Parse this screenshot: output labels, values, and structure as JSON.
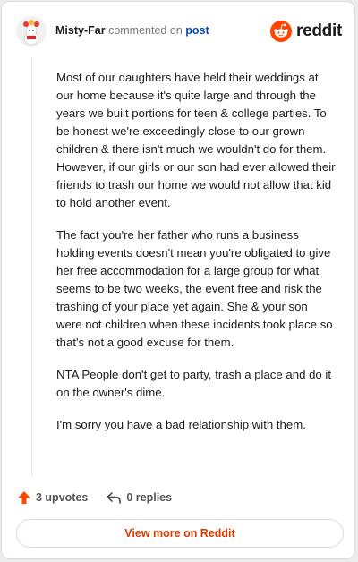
{
  "comment": {
    "username": "Misty-Far",
    "action_text": "commented on",
    "post_link": "post",
    "paragraphs": [
      "Most of our daughters have held their weddings at our home because it's quite large and through the years we built portions for teen & college parties. To be honest we're exceedingly close to our grown children & there isn't much we wouldn't do for them. However, if our girls or our son had ever allowed their friends to trash our home we would not allow that kid to hold another event.",
      "The fact you're her father who runs a business holding events doesn't mean you're obligated to give her free accommodation for a large group for what seems to be two weeks, the event free and risk the trashing of your place yet again. She & your son were not children when these incidents took place so that's not a good excuse for them.",
      "NTA People don't get to party, trash a place and do it on the owner's dime.",
      "I'm sorry you have a bad relationship with them."
    ]
  },
  "brand": {
    "wordmark": "reddit",
    "icon": "reddit-logo-icon",
    "color": "#ff4500"
  },
  "actions": {
    "upvotes": "3 upvotes",
    "replies": "0 replies"
  },
  "footer": {
    "view_more": "View more on Reddit"
  },
  "colors": {
    "accent": "#d93a00",
    "upvote": "#ff4500",
    "link": "#0a4bb5"
  }
}
